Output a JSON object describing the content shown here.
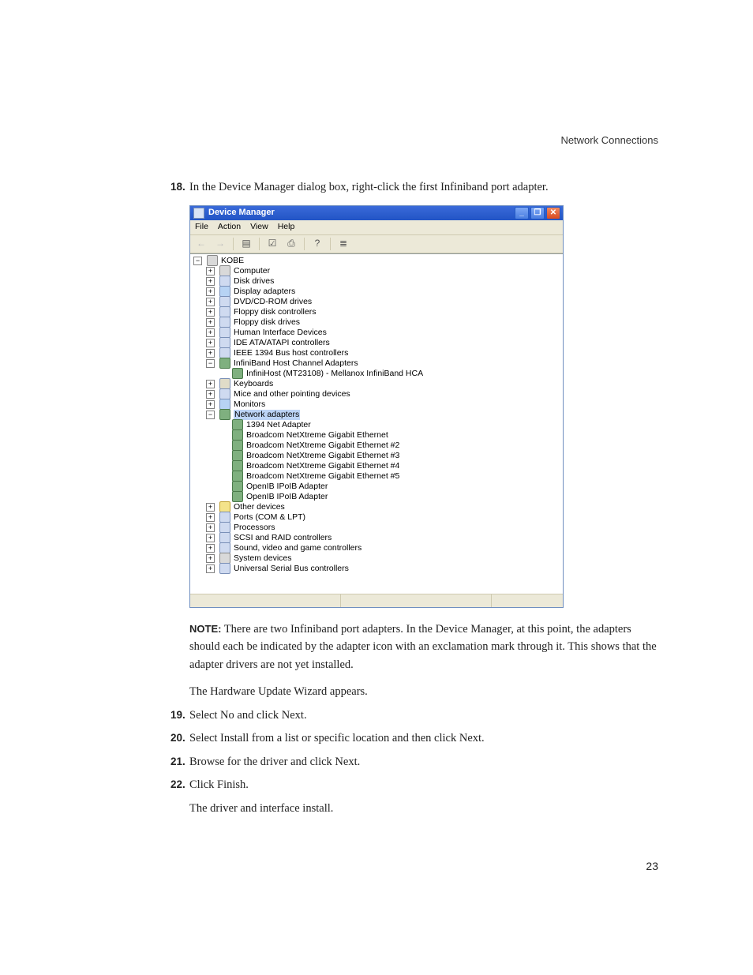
{
  "header": {
    "running_title": "Network Connections"
  },
  "page_number": "23",
  "step18": {
    "num": "18.",
    "text": "In the Device Manager dialog box, right-click the first Infiniband port adapter."
  },
  "note": {
    "label": "NOTE:",
    "text": "There are two Infiniband port adapters. In the Device Manager, at this point, the adapters should each be indicated by the adapter icon with an exclamation mark through it. This shows that the adapter drivers are not yet installed."
  },
  "para_wizard": "The Hardware Update Wizard appears.",
  "step19": {
    "num": "19.",
    "text": "Select No and click Next."
  },
  "step20": {
    "num": "20.",
    "text": "Select Install from a list or specific location and then click Next."
  },
  "step21": {
    "num": "21.",
    "text": "Browse for the driver and click Next."
  },
  "step22": {
    "num": "22.",
    "text": "Click Finish."
  },
  "para_install": "The driver and interface install.",
  "window": {
    "title": "Device Manager",
    "menus": {
      "file": "File",
      "action": "Action",
      "view": "View",
      "help": "Help"
    },
    "root": "KOBE",
    "cats": {
      "computer": "Computer",
      "disk": "Disk drives",
      "display": "Display adapters",
      "dvd": "DVD/CD-ROM drives",
      "floppyctl": "Floppy disk controllers",
      "floppy": "Floppy disk drives",
      "hid": "Human Interface Devices",
      "ide": "IDE ATA/ATAPI controllers",
      "ieee": "IEEE 1394 Bus host controllers",
      "ibhca": "InfiniBand Host Channel Adapters",
      "ibhca_child": "InfiniHost (MT23108) - Mellanox InfiniBand HCA",
      "keyboards": "Keyboards",
      "mice": "Mice and other pointing devices",
      "monitors": "Monitors",
      "netadapters": "Network adapters",
      "other": "Other devices",
      "ports": "Ports (COM & LPT)",
      "proc": "Processors",
      "scsi": "SCSI and RAID controllers",
      "sound": "Sound, video and game controllers",
      "sysdev": "System devices",
      "usb": "Universal Serial Bus controllers"
    },
    "net": {
      "a": "1394 Net Adapter",
      "b1": "Broadcom NetXtreme Gigabit Ethernet",
      "b2": "Broadcom NetXtreme Gigabit Ethernet #2",
      "b3": "Broadcom NetXtreme Gigabit Ethernet #3",
      "b4": "Broadcom NetXtreme Gigabit Ethernet #4",
      "b5": "Broadcom NetXtreme Gigabit Ethernet #5",
      "o1": "OpenIB IPoIB Adapter",
      "o2": "OpenIB IPoIB Adapter"
    }
  }
}
